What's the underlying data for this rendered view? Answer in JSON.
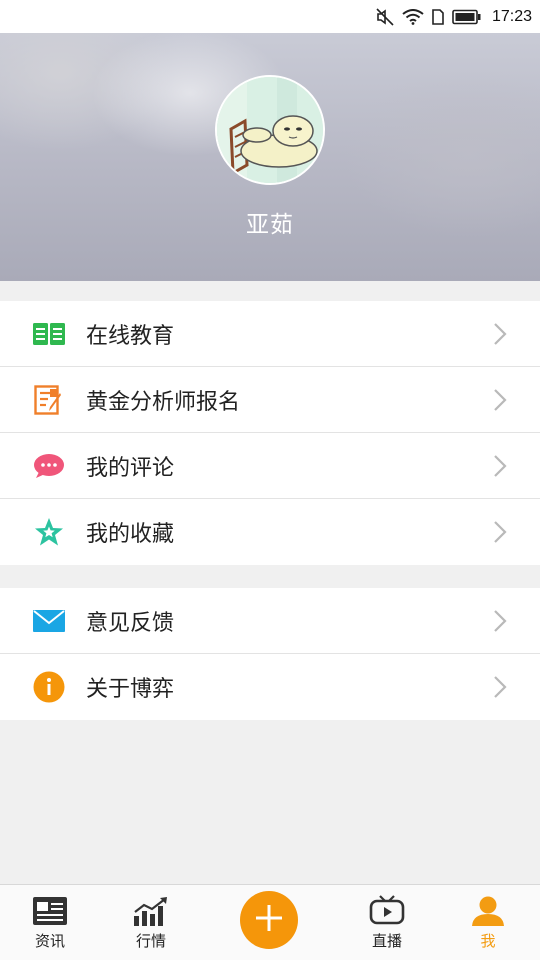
{
  "status_bar": {
    "time": "17:23",
    "icons": [
      "mute-icon",
      "wifi-icon",
      "sim-icon",
      "battery-icon"
    ]
  },
  "profile": {
    "username": "亚茹",
    "avatar": "cartoon-avatar"
  },
  "menu": {
    "group1": [
      {
        "label": "在线教育",
        "icon": "book-icon",
        "color": "#2fb84f"
      },
      {
        "label": "黄金分析师报名",
        "icon": "form-icon",
        "color": "#f07f2a"
      },
      {
        "label": "我的评论",
        "icon": "comment-icon",
        "color": "#f0567a"
      },
      {
        "label": "我的收藏",
        "icon": "star-icon",
        "color": "#2cc3a0"
      }
    ],
    "group2": [
      {
        "label": "意见反馈",
        "icon": "mail-icon",
        "color": "#1aa6e4"
      },
      {
        "label": "关于博弈",
        "icon": "info-icon",
        "color": "#f5960a"
      }
    ]
  },
  "tab_bar": {
    "tabs": [
      {
        "label": "资讯",
        "icon": "news-icon"
      },
      {
        "label": "行情",
        "icon": "chart-icon"
      },
      {
        "label": "直播",
        "icon": "tv-icon"
      },
      {
        "label": "我",
        "icon": "person-icon"
      }
    ],
    "add_icon": "plus-icon",
    "active_color": "#f39c12"
  }
}
